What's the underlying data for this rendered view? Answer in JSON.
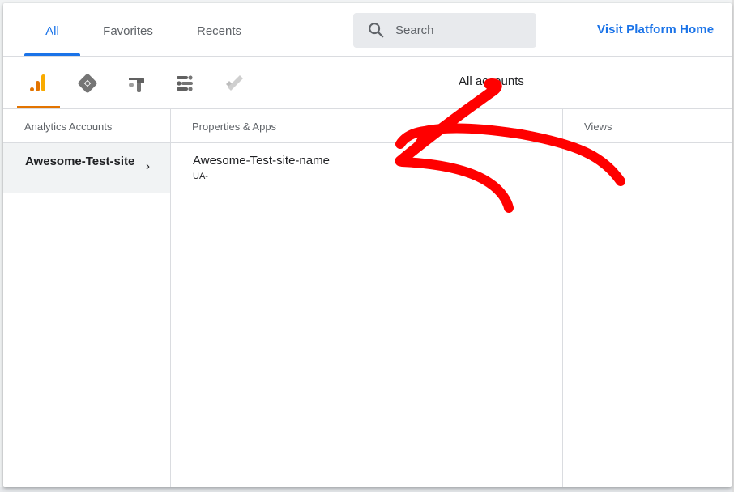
{
  "tabs": [
    {
      "label": "All",
      "active": true
    },
    {
      "label": "Favorites",
      "active": false
    },
    {
      "label": "Recents",
      "active": false
    }
  ],
  "search": {
    "placeholder": "Search"
  },
  "visit_platform": {
    "label": "Visit Platform Home"
  },
  "products": [
    {
      "icon": "analytics-icon",
      "selected": true
    },
    {
      "icon": "tag-manager-icon",
      "selected": false
    },
    {
      "icon": "optimize-icon",
      "selected": false
    },
    {
      "icon": "data-studio-icon",
      "selected": false
    },
    {
      "icon": "surveys-check-icon",
      "selected": false
    }
  ],
  "scope_label": "All accounts",
  "columns": {
    "accounts": {
      "header": "Analytics Accounts",
      "items": [
        {
          "name": "Awesome-Test-site",
          "selected": true
        }
      ]
    },
    "properties": {
      "header": "Properties & Apps",
      "items": [
        {
          "name": "Awesome-Test-site-name",
          "id": "UA-"
        }
      ]
    },
    "views": {
      "header": "Views"
    }
  },
  "colors": {
    "accent": "#1a73e8",
    "analytics_orange": "#e37400",
    "annotation_red": "#ff0000"
  }
}
